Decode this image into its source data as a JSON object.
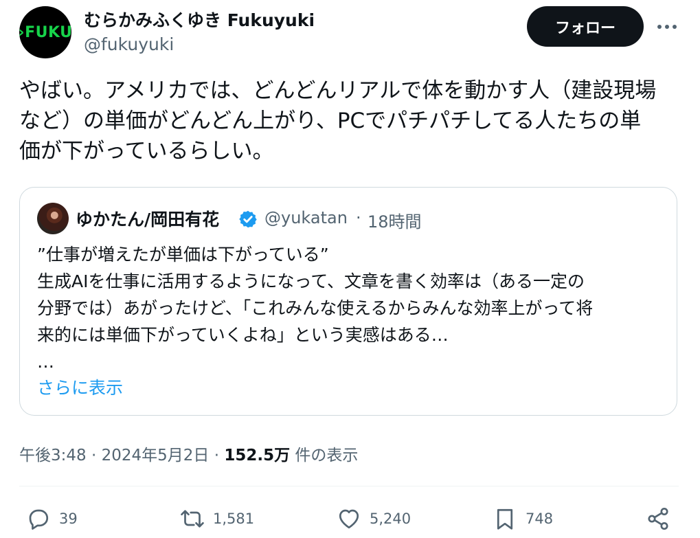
{
  "author": {
    "avatar_text": "›FUKU",
    "name": "むらかみふくゆき Fukuyuki",
    "handle": "@fukuyuki"
  },
  "follow_label": "フォロー",
  "tweet_text": "やばい。アメリカでは、どんどんリアルで体を動かす人（建設現場\nなど）の単価がどんどん上がり、PCでパチパチしてる人たちの単\n価が下がっているらしい。",
  "quote": {
    "name": "ゆかたん/岡田有花",
    "handle": "@yukatan",
    "separator": "·",
    "time": "18時間",
    "body": "”仕事が増えたが単価は下がっている”\n生成AIを仕事に活用するようになって、文章を書く効率は（ある一定の\n分野では）あがったけど、「これみんな使えるからみんな効率上がって将\n来的には単価下がっていくよね」という実感はある…\n…",
    "show_more": "さらに表示"
  },
  "meta": {
    "time": "午後3:48",
    "dot1": "·",
    "date": "2024年5月2日",
    "dot2": "·",
    "views_count": "152.5万",
    "views_label": "件の表示"
  },
  "actions": {
    "replies": "39",
    "retweets": "1,581",
    "likes": "5,240",
    "bookmarks": "748"
  },
  "colors": {
    "accent": "#1d9bf0",
    "text": "#0f1419",
    "muted": "#536471",
    "border": "#cfd9de"
  },
  "icons": [
    "more-icon",
    "verified-badge-icon",
    "reply-icon",
    "retweet-icon",
    "like-icon",
    "bookmark-icon",
    "share-icon"
  ]
}
